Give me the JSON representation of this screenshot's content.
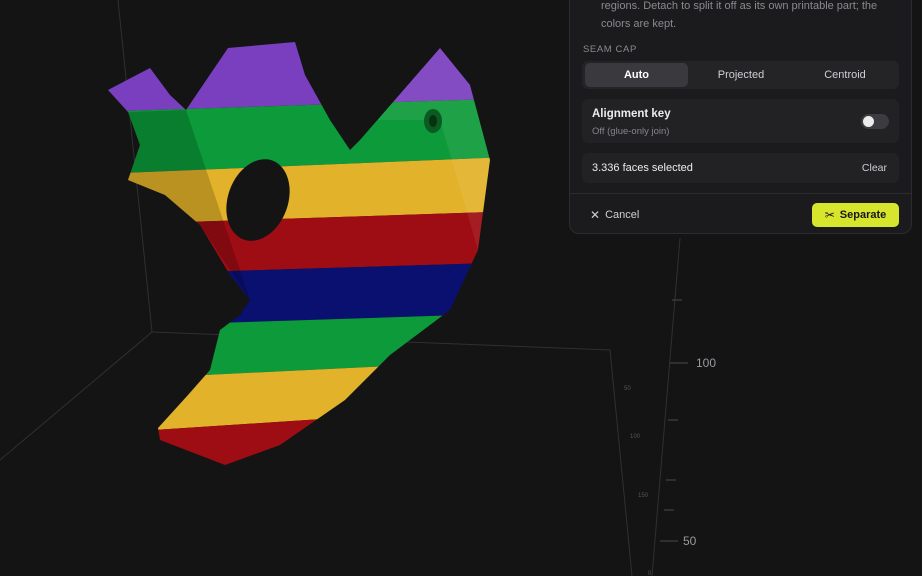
{
  "panel": {
    "description_line1": "regions. Detach to split it off as its own printable part; the",
    "description_line2": "colors are kept.",
    "seam_cap_label": "SEAM CAP",
    "seam_cap_options": [
      {
        "label": "Auto",
        "active": true
      },
      {
        "label": "Projected",
        "active": false
      },
      {
        "label": "Centroid",
        "active": false
      }
    ],
    "alignment_key": {
      "title": "Alignment key",
      "subtitle": "Off (glue-only join)",
      "enabled": false
    },
    "selection": {
      "text": "3.336 faces selected",
      "clear_label": "Clear"
    },
    "cancel_label": "Cancel",
    "separate_label": "Separate",
    "accent_color": "#d8e52d"
  },
  "viewport": {
    "axis_ticks": [
      "100",
      "50"
    ],
    "small_ticks": [
      "150",
      "100",
      "50",
      "0"
    ],
    "colors": {
      "purple": "#7a3fbf",
      "green": "#0d9a3a",
      "yellow": "#e2b22a",
      "red": "#9e0c14",
      "blue": "#0a1070",
      "background": "#141414"
    }
  }
}
